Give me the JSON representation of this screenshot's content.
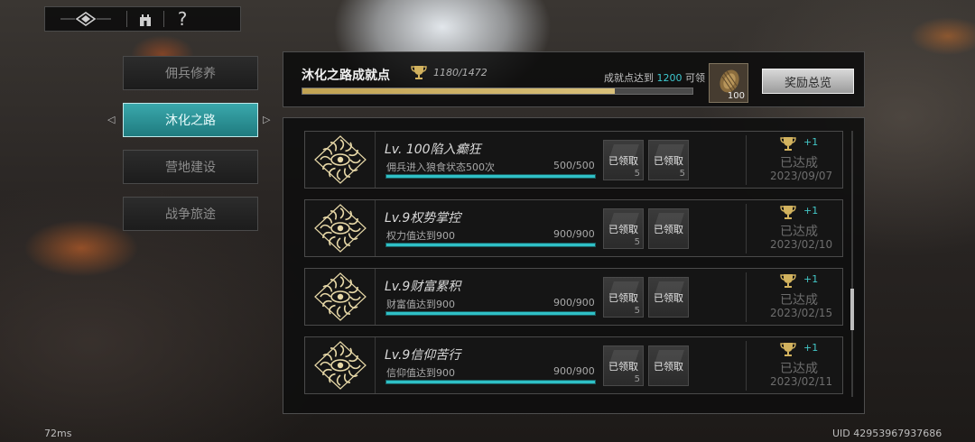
{
  "topnav": {
    "logo_icon": "emblem-icon",
    "tower_icon": "tower-icon",
    "help_label": "?"
  },
  "tabs": [
    {
      "label": "佣兵修养",
      "active": false
    },
    {
      "label": "沐化之路",
      "active": true
    },
    {
      "label": "营地建设",
      "active": false
    },
    {
      "label": "战争旅途",
      "active": false
    }
  ],
  "tab_arrows": {
    "left": "◁",
    "right": "▷"
  },
  "header": {
    "title": "沐化之路成就点",
    "score": "1180/1472",
    "progress": 0.8016,
    "requirement_prefix": "成就点达到",
    "requirement_value": "1200",
    "requirement_suffix": "可领",
    "reward_qty": "100",
    "overview_label": "奖励总览"
  },
  "achievements": [
    {
      "name": "Lv. 100陷入癫狂",
      "desc": "佣兵进入狼食状态500次",
      "progress_text": "500/500",
      "progress": 1.0,
      "claim1": "已领取",
      "claim1_qty": "5",
      "claim2": "已领取",
      "claim2_qty": "5",
      "points": "+1",
      "status": "已达成",
      "date": "2023/09/07"
    },
    {
      "name": "Lv.9权势掌控",
      "desc": "权力值达到900",
      "progress_text": "900/900",
      "progress": 1.0,
      "claim1": "已领取",
      "claim1_qty": "5",
      "claim2": "已领取",
      "claim2_qty": "",
      "points": "+1",
      "status": "已达成",
      "date": "2023/02/10"
    },
    {
      "name": "Lv.9财富累积",
      "desc": "财富值达到900",
      "progress_text": "900/900",
      "progress": 1.0,
      "claim1": "已领取",
      "claim1_qty": "5",
      "claim2": "已领取",
      "claim2_qty": "",
      "points": "+1",
      "status": "已达成",
      "date": "2023/02/15"
    },
    {
      "name": "Lv.9信仰苦行",
      "desc": "信仰值达到900",
      "progress_text": "900/900",
      "progress": 1.0,
      "claim1": "已领取",
      "claim1_qty": "5",
      "claim2": "已领取",
      "claim2_qty": "",
      "points": "+1",
      "status": "已达成",
      "date": "2023/02/11"
    }
  ],
  "footer": {
    "latency": "72ms",
    "uid": "UID 42953967937686"
  },
  "colors": {
    "accent_teal": "#2fc0c6",
    "gold": "#d2b25e",
    "active_tab": "#2f9a9e"
  }
}
